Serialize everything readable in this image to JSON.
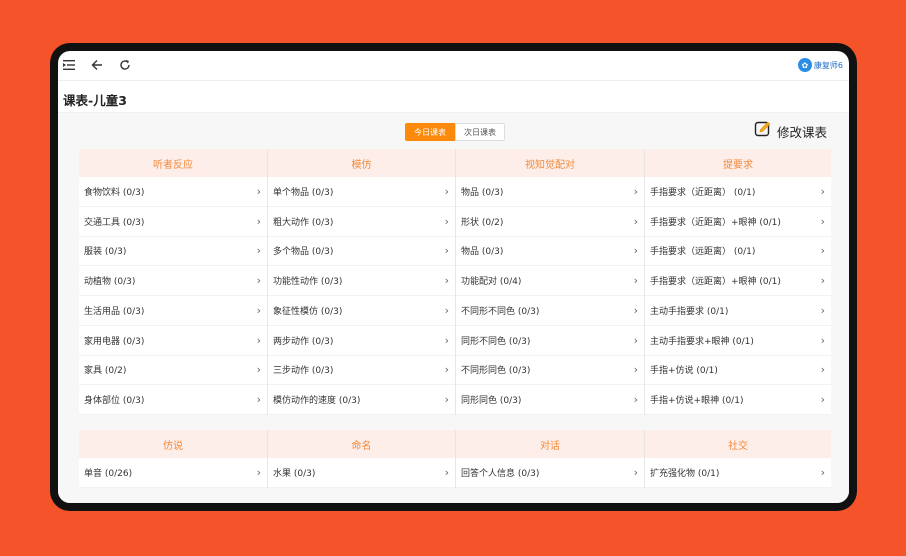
{
  "toolbar": {
    "menu_icon": "menu-collapse-icon",
    "back_icon": "arrow-left-icon",
    "refresh_icon": "refresh-icon",
    "brand_text": "康复师6"
  },
  "page_title": "课表-儿童3",
  "schedule_tabs": [
    {
      "label": "今日课表",
      "active": true
    },
    {
      "label": "次日课表",
      "active": false
    }
  ],
  "edit_button": {
    "label": "修改课表",
    "icon": "pencil-edit-icon"
  },
  "section_a": [
    {
      "title": "听者反应",
      "items": [
        "食物饮料 (0/3)",
        "交通工具 (0/3)",
        "服装 (0/3)",
        "动植物 (0/3)",
        "生活用品 (0/3)",
        "家用电器 (0/3)",
        "家具 (0/2)",
        "身体部位 (0/3)"
      ]
    },
    {
      "title": "模仿",
      "items": [
        "单个物品 (0/3)",
        "粗大动作 (0/3)",
        "多个物品 (0/3)",
        "功能性动作 (0/3)",
        "象征性模仿 (0/3)",
        "两步动作 (0/3)",
        "三步动作 (0/3)",
        "模仿动作的速度 (0/3)"
      ]
    },
    {
      "title": "视知觉配对",
      "items": [
        "物品 (0/3)",
        "形状 (0/2)",
        "物品 (0/3)",
        "功能配对 (0/4)",
        "不同形不同色 (0/3)",
        "同形不同色 (0/3)",
        "不同形同色 (0/3)",
        "同形同色 (0/3)"
      ]
    },
    {
      "title": "提要求",
      "items": [
        "手指要求（近距离） (0/1)",
        "手指要求（近距离）+眼神 (0/1)",
        "手指要求（远距离） (0/1)",
        "手指要求（远距离）+眼神 (0/1)",
        "主动手指要求 (0/1)",
        "主动手指要求+眼神 (0/1)",
        "手指+仿说 (0/1)",
        "手指+仿说+眼神 (0/1)"
      ]
    }
  ],
  "section_b": [
    {
      "title": "仿说",
      "items": [
        "单音 (0/26)"
      ]
    },
    {
      "title": "命名",
      "items": [
        "水果 (0/3)"
      ]
    },
    {
      "title": "对话",
      "items": [
        "回答个人信息 (0/3)"
      ]
    },
    {
      "title": "社交",
      "items": [
        "扩充强化物 (0/1)"
      ]
    }
  ],
  "colors": {
    "background": "#F5532A",
    "accent": "#FB8A0C",
    "header_bg": "#FEEEEA",
    "header_text": "#F28A3B"
  }
}
